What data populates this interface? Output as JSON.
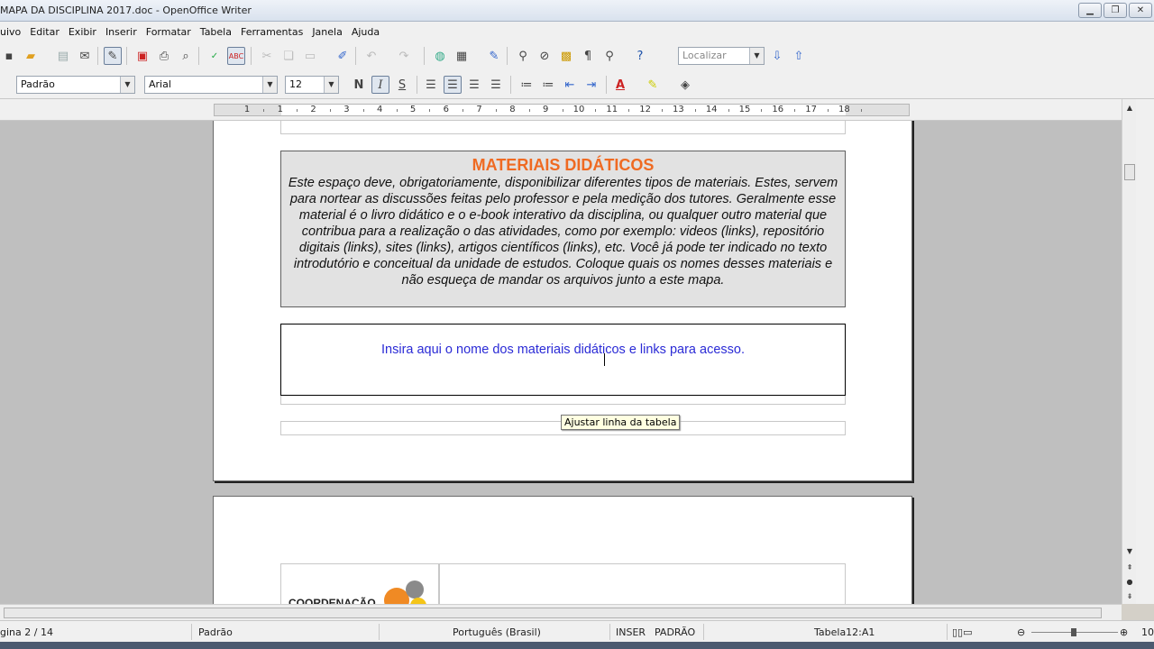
{
  "window": {
    "title": "MAPA DA DISCIPLINA 2017.doc - OpenOffice Writer"
  },
  "menu": [
    "uivo",
    "Editar",
    "Exibir",
    "Inserir",
    "Formatar",
    "Tabela",
    "Ferramentas",
    "Janela",
    "Ajuda"
  ],
  "toolbar": {
    "find_placeholder": "Localizar",
    "paragraph_style": "Padrão",
    "font_name": "Arial",
    "font_size": "12",
    "bold_label": "N",
    "italic_label": "I",
    "underline_label": "S"
  },
  "ruler": {
    "labels": [
      "1",
      "1",
      "2",
      "3",
      "4",
      "5",
      "6",
      "7",
      "8",
      "9",
      "10",
      "11",
      "12",
      "13",
      "14",
      "15",
      "16",
      "17",
      "18"
    ]
  },
  "document": {
    "section_title": "MATERIAIS DIDÁTICOS",
    "section_body": "Este espaço deve, obrigatoriamente, disponibilizar diferentes tipos de materiais. Estes, servem para nortear as discussões feitas pelo professor e pela medição dos tutores. Geralmente esse material é o livro didático e o e-book interativo da disciplina, ou qualquer outro material que contribua para a realização o das atividades, como por exemplo: videos (links), repositório digitais (links), sites (links), artigos científicos (links), etc. Você já pode ter indicado no texto introdutório e conceitual da unidade de estudos. Coloque quais os nomes desses materiais e não esqueça de mandar os arquivos junto a este mapa.",
    "placeholder_text": "Insira aqui o nome dos materiais didáticos e links para acesso.",
    "tooltip": "Ajustar linha da tabela",
    "page2_label": "COORDENAÇÃO"
  },
  "status": {
    "page": "gina 2 / 14",
    "style": "Padrão",
    "language": "Português (Brasil)",
    "insert_mode": "INSER",
    "selection_mode": "PADRÃO",
    "table_cell": "Tabela12:A1",
    "zoom": "10"
  },
  "colors": {
    "section_title": "#ef6a22",
    "placeholder_text": "#2b2bd6"
  }
}
